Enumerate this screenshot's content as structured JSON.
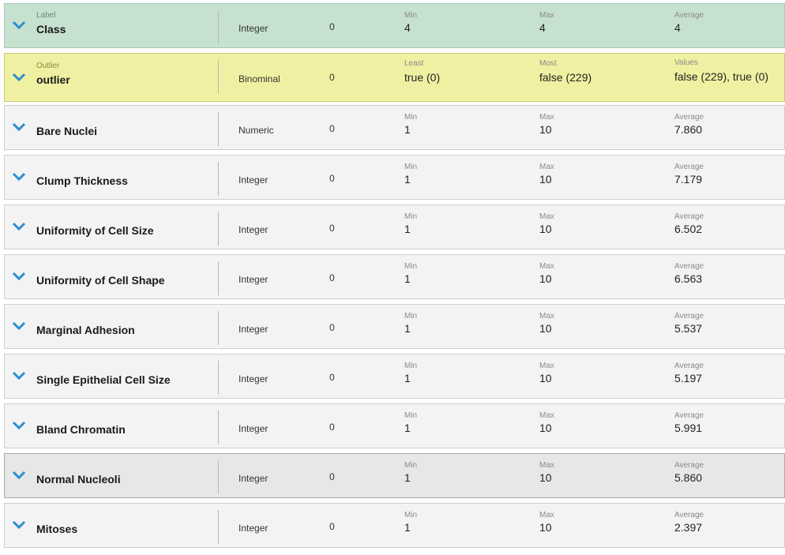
{
  "rows": [
    {
      "role": "Label",
      "name": "Class",
      "type": "Integer",
      "missing": "0",
      "s1_label": "Min",
      "s1_value": "4",
      "s2_label": "Max",
      "s2_value": "4",
      "s3_label": "Average",
      "s3_value": "4"
    },
    {
      "role": "Outlier",
      "name": "outlier",
      "type": "Binominal",
      "missing": "0",
      "s1_label": "Least",
      "s1_value": "true (0)",
      "s2_label": "Most",
      "s2_value": "false (229)",
      "s3_label": "Values",
      "s3_value": "false (229), true (0)"
    },
    {
      "role": "",
      "name": "Bare Nuclei",
      "type": "Numeric",
      "missing": "0",
      "s1_label": "Min",
      "s1_value": "1",
      "s2_label": "Max",
      "s2_value": "10",
      "s3_label": "Average",
      "s3_value": "7.860"
    },
    {
      "role": "",
      "name": "Clump Thickness",
      "type": "Integer",
      "missing": "0",
      "s1_label": "Min",
      "s1_value": "1",
      "s2_label": "Max",
      "s2_value": "10",
      "s3_label": "Average",
      "s3_value": "7.179"
    },
    {
      "role": "",
      "name": "Uniformity of Cell Size",
      "type": "Integer",
      "missing": "0",
      "s1_label": "Min",
      "s1_value": "1",
      "s2_label": "Max",
      "s2_value": "10",
      "s3_label": "Average",
      "s3_value": "6.502"
    },
    {
      "role": "",
      "name": "Uniformity of Cell Shape",
      "type": "Integer",
      "missing": "0",
      "s1_label": "Min",
      "s1_value": "1",
      "s2_label": "Max",
      "s2_value": "10",
      "s3_label": "Average",
      "s3_value": "6.563"
    },
    {
      "role": "",
      "name": "Marginal Adhesion",
      "type": "Integer",
      "missing": "0",
      "s1_label": "Min",
      "s1_value": "1",
      "s2_label": "Max",
      "s2_value": "10",
      "s3_label": "Average",
      "s3_value": "5.537"
    },
    {
      "role": "",
      "name": "Single Epithelial Cell Size",
      "type": "Integer",
      "missing": "0",
      "s1_label": "Min",
      "s1_value": "1",
      "s2_label": "Max",
      "s2_value": "10",
      "s3_label": "Average",
      "s3_value": "5.197"
    },
    {
      "role": "",
      "name": "Bland Chromatin",
      "type": "Integer",
      "missing": "0",
      "s1_label": "Min",
      "s1_value": "1",
      "s2_label": "Max",
      "s2_value": "10",
      "s3_label": "Average",
      "s3_value": "5.991"
    },
    {
      "role": "",
      "name": "Normal Nucleoli",
      "type": "Integer",
      "missing": "0",
      "s1_label": "Min",
      "s1_value": "1",
      "s2_label": "Max",
      "s2_value": "10",
      "s3_label": "Average",
      "s3_value": "5.860"
    },
    {
      "role": "",
      "name": "Mitoses",
      "type": "Integer",
      "missing": "0",
      "s1_label": "Min",
      "s1_value": "1",
      "s2_label": "Max",
      "s2_value": "10",
      "s3_label": "Average",
      "s3_value": "2.397"
    }
  ],
  "colors": {
    "label_row": "#c6e1cf",
    "outlier_row": "#f0f0a2",
    "normal_row": "#f3f3f3",
    "selected_row": "#e7e7e7",
    "chevron": "#2b8fd0"
  },
  "icons": {
    "expand": "chevron-down-icon"
  }
}
